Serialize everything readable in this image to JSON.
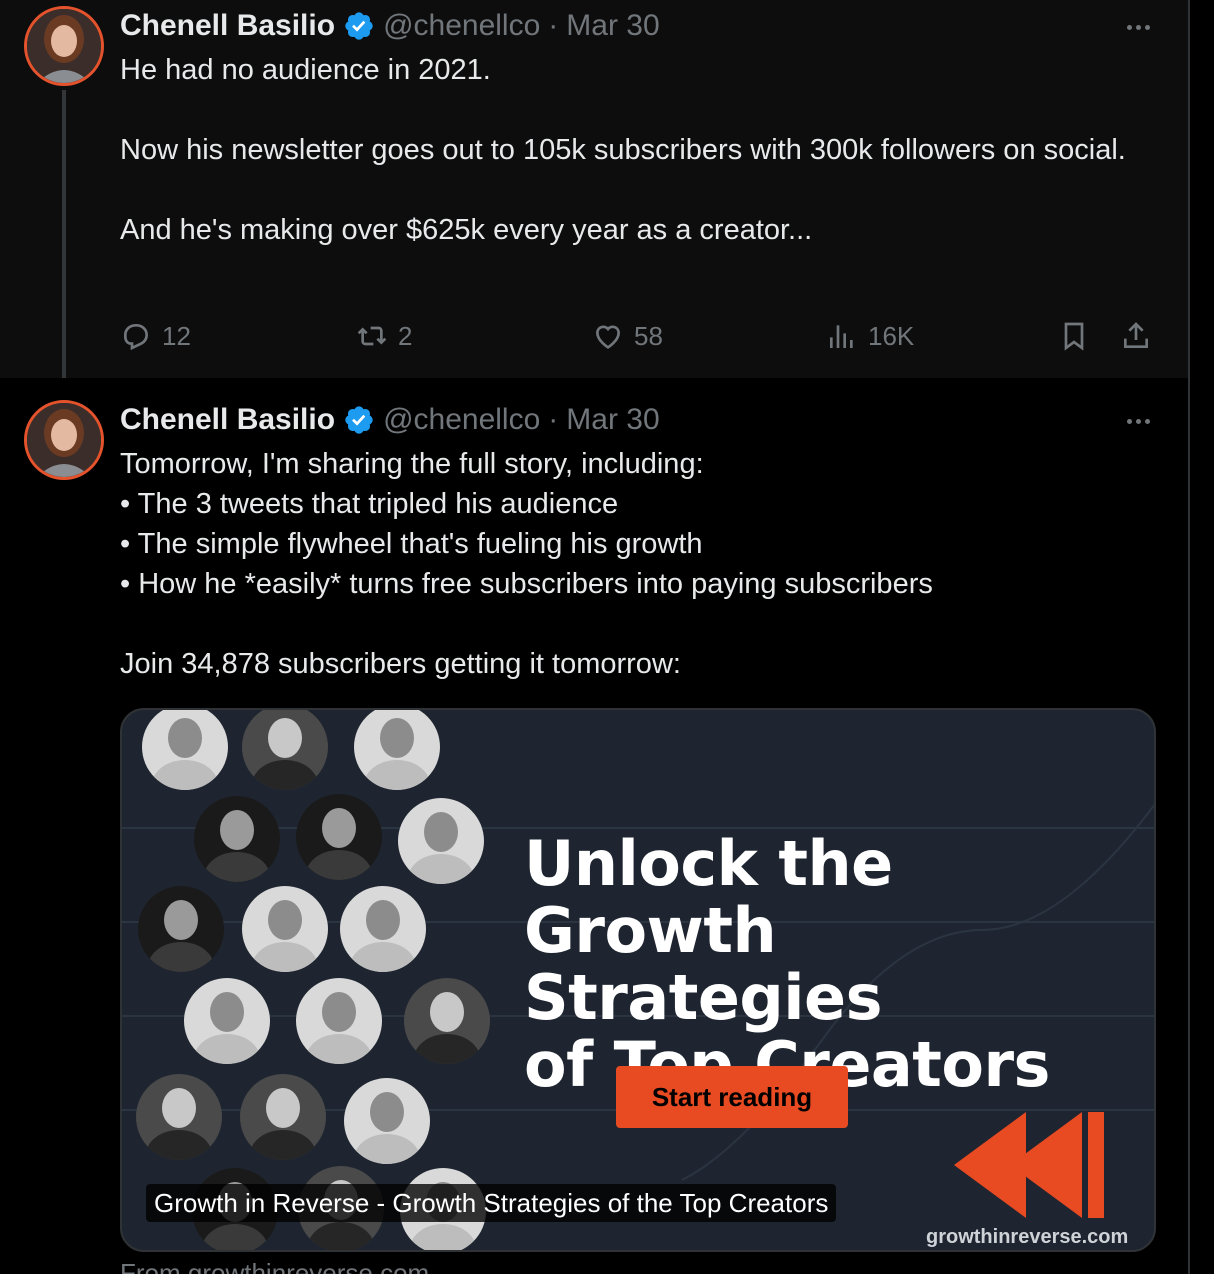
{
  "colors": {
    "accent_orange": "#e84a22",
    "verified_blue": "#1d9bf0",
    "muted_text": "#71767b",
    "primary_text": "#e7e9ea"
  },
  "tweets": [
    {
      "author_name": "Chenell Basilio",
      "handle": "@chenellco",
      "separator": "·",
      "date": "Mar 30",
      "text_lines": [
        "He had no audience in 2021.",
        "",
        "Now his newsletter goes out to 105k subscribers with 300k followers on social.",
        "",
        "And he's making over $625k every year as a creator..."
      ],
      "actions": {
        "replies": "12",
        "reposts": "2",
        "likes": "58",
        "views": "16K"
      }
    },
    {
      "author_name": "Chenell Basilio",
      "handle": "@chenellco",
      "separator": "·",
      "date": "Mar 30",
      "text_lines": [
        "Tomorrow, I'm sharing the full story, including:",
        "• The 3 tweets that tripled his audience",
        "• The simple flywheel that's fueling his growth",
        "• How he *easily* turns free subscribers into paying subscribers",
        "",
        "Join 34,878 subscribers getting it tomorrow:"
      ],
      "card": {
        "headline": "Unlock the Growth\nStrategies\nof Top Creators",
        "cta_label": "Start reading",
        "domain_on_image": "growthinreverse.com",
        "title": "Growth in Reverse - Growth Strategies of the Top Creators",
        "from_line": "From growthinreverse.com"
      }
    }
  ],
  "icons": {
    "verified": "verified-badge-icon",
    "more": "more-horizontal-icon",
    "reply": "reply-icon",
    "repost": "repost-icon",
    "like": "heart-icon",
    "views": "views-chart-icon",
    "bookmark": "bookmark-icon",
    "share": "share-icon"
  }
}
